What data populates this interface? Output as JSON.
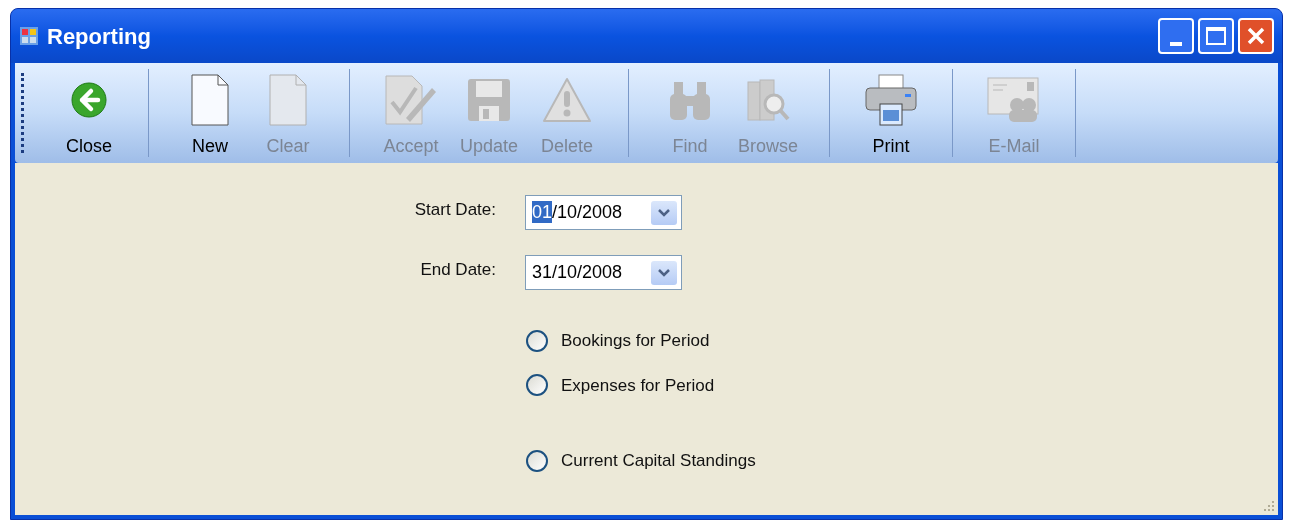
{
  "window": {
    "title": "Reporting"
  },
  "toolbar": [
    [
      {
        "kind": "close",
        "label": "Close",
        "disabled": false
      }
    ],
    [
      {
        "kind": "new",
        "label": "New",
        "disabled": false
      },
      {
        "kind": "clear",
        "label": "Clear",
        "disabled": true
      }
    ],
    [
      {
        "kind": "accept",
        "label": "Accept",
        "disabled": true
      },
      {
        "kind": "update",
        "label": "Update",
        "disabled": true
      },
      {
        "kind": "delete",
        "label": "Delete",
        "disabled": true
      }
    ],
    [
      {
        "kind": "find",
        "label": "Find",
        "disabled": true
      },
      {
        "kind": "browse",
        "label": "Browse",
        "disabled": true
      }
    ],
    [
      {
        "kind": "print",
        "label": "Print",
        "disabled": false
      }
    ],
    [
      {
        "kind": "email",
        "label": "E-Mail",
        "disabled": true
      }
    ]
  ],
  "dates": [
    {
      "label": "Start Date:",
      "highlighted": "01",
      "rest": "/10/2008"
    },
    {
      "label": "End Date:",
      "rest": "31/10/2008"
    }
  ],
  "reports": [
    {
      "label": "Bookings for Period",
      "selected": false
    },
    {
      "label": "Expenses for Period",
      "selected": false
    },
    {
      "label": "Current Capital Standings",
      "selected": false
    }
  ]
}
